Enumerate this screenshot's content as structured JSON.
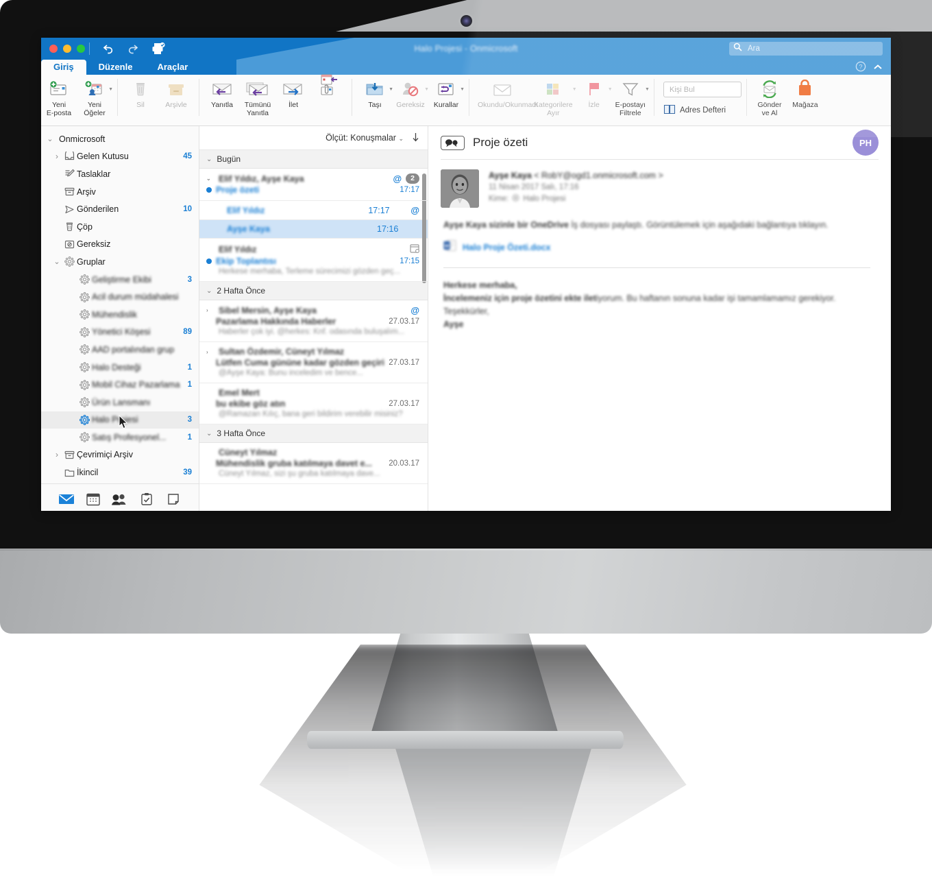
{
  "window": {
    "title": "Halo Projesi - Onmicrosoft",
    "search": {
      "placeholder": "Ara",
      "value": ""
    },
    "traffic_lights": [
      "close-red",
      "minimize-yellow",
      "zoom-green"
    ],
    "quick_access": [
      "undo-icon",
      "redo-icon",
      "print-icon"
    ],
    "help_icon": "help-circle-icon",
    "collapse_icon": "chevron-up-icon"
  },
  "ribbon": {
    "tabs": [
      {
        "label": "Giriş",
        "active": true
      },
      {
        "label": "Düzenle",
        "active": false
      },
      {
        "label": "Araçlar",
        "active": false
      }
    ],
    "groups": [
      {
        "items": [
          {
            "label": "Yeni\nE-posta",
            "icon": "new-email-icon",
            "dim": false,
            "caret": false
          },
          {
            "label": "Yeni\nÖğeler",
            "icon": "new-items-icon",
            "dim": false,
            "caret": true
          }
        ]
      },
      {
        "items": [
          {
            "label": "Sil",
            "icon": "trash-icon",
            "dim": true,
            "caret": false
          },
          {
            "label": "Arşivle",
            "icon": "archive-icon",
            "dim": true,
            "caret": false
          }
        ]
      },
      {
        "items": [
          {
            "label": "Yanıtla",
            "icon": "reply-icon",
            "dim": false,
            "caret": false
          },
          {
            "label": "Tümünü\nYanıtla",
            "icon": "reply-all-icon",
            "dim": false,
            "caret": false
          },
          {
            "label": "İlet",
            "icon": "forward-icon",
            "dim": false,
            "caret": false
          },
          {
            "label": "",
            "icon": "meeting-attachment-icon",
            "dim": false,
            "caret": false
          }
        ]
      },
      {
        "items": [
          {
            "label": "Taşı",
            "icon": "move-folder-icon",
            "dim": false,
            "caret": true
          },
          {
            "label": "Gereksiz",
            "icon": "junk-icon",
            "dim": true,
            "caret": true
          },
          {
            "label": "Kurallar",
            "icon": "rules-icon",
            "dim": false,
            "caret": true
          }
        ]
      },
      {
        "items": [
          {
            "label": "Okundu/Okunmadı",
            "icon": "envelope-icon",
            "dim": true,
            "caret": false
          },
          {
            "label": "Kategorilere\nAyır",
            "icon": "categorize-icon",
            "dim": true,
            "caret": true
          },
          {
            "label": "İzle",
            "icon": "flag-icon",
            "dim": true,
            "caret": true
          },
          {
            "label": "E-postayı\nFiltrele",
            "icon": "filter-funnel-icon",
            "dim": false,
            "caret": true
          }
        ]
      },
      {
        "items": [
          {
            "label": "Gönder\nve Al",
            "icon": "send-receive-icon",
            "dim": false,
            "caret": false
          },
          {
            "label": "Mağaza",
            "icon": "store-bag-icon",
            "dim": false,
            "caret": false
          }
        ]
      }
    ],
    "find_contact": {
      "placeholder": "Kişi Bul",
      "value": ""
    },
    "address_book_label": "Adres Defteri",
    "address_book_icon": "address-book-icon"
  },
  "sidebar": {
    "account": {
      "label": "Onmicrosoft",
      "icon": "chevron-down-icon",
      "indent": 0
    },
    "folders": [
      {
        "label": "Gelen Kutusu",
        "count": "45",
        "icon": "inbox-icon",
        "chevron": "chevron-right-icon",
        "indent": 1,
        "blurred": false
      },
      {
        "label": "Taslaklar",
        "count": "",
        "icon": "drafts-icon",
        "chevron": "",
        "indent": 1,
        "blurred": false
      },
      {
        "label": "Arşiv",
        "count": "",
        "icon": "archive-box-icon",
        "chevron": "",
        "indent": 1,
        "blurred": false
      },
      {
        "label": "Gönderilen",
        "count": "10",
        "icon": "sent-icon",
        "chevron": "",
        "indent": 1,
        "blurred": false
      },
      {
        "label": "Çöp",
        "count": "",
        "icon": "trash-icon",
        "chevron": "",
        "indent": 1,
        "blurred": false
      },
      {
        "label": "Gereksiz",
        "count": "",
        "icon": "junk-folder-icon",
        "chevron": "",
        "indent": 1,
        "blurred": false
      },
      {
        "label": "Gruplar",
        "count": "",
        "icon": "group-icon",
        "chevron": "chevron-down-icon",
        "indent": 1,
        "blurred": false
      },
      {
        "label": "Geliştirme Ekibi",
        "count": "3",
        "icon": "group-icon",
        "chevron": "",
        "indent": 2,
        "blurred": true
      },
      {
        "label": "Acil durum müdahalesi",
        "count": "",
        "icon": "group-icon",
        "chevron": "",
        "indent": 2,
        "blurred": true
      },
      {
        "label": "Mühendislik",
        "count": "",
        "icon": "group-icon",
        "chevron": "",
        "indent": 2,
        "blurred": true
      },
      {
        "label": "Yönetici Köşesi",
        "count": "89",
        "icon": "group-icon",
        "chevron": "",
        "indent": 2,
        "blurred": true
      },
      {
        "label": "AAD portalından grup",
        "count": "",
        "icon": "group-icon",
        "chevron": "",
        "indent": 2,
        "blurred": true
      },
      {
        "label": "Halo Desteği",
        "count": "1",
        "icon": "group-icon",
        "chevron": "",
        "indent": 2,
        "blurred": true
      },
      {
        "label": "Mobil Cihaz Pazarlama",
        "count": "1",
        "icon": "group-icon",
        "chevron": "",
        "indent": 2,
        "blurred": true
      },
      {
        "label": "Ürün Lansmanı",
        "count": "",
        "icon": "group-icon",
        "chevron": "",
        "indent": 2,
        "blurred": true
      },
      {
        "label": "Halo Projesi",
        "count": "3",
        "icon": "group-icon-selected",
        "chevron": "",
        "indent": 2,
        "blurred": true,
        "selected": true
      },
      {
        "label": "Satış Profesyonel...",
        "count": "1",
        "icon": "group-icon",
        "chevron": "",
        "indent": 2,
        "blurred": true
      },
      {
        "label": "Çevrimiçi Arşiv",
        "count": "",
        "icon": "archive-box-icon",
        "chevron": "chevron-right-icon",
        "indent": 1,
        "blurred": false
      },
      {
        "label": "İkincil",
        "count": "39",
        "icon": "folder-icon",
        "chevron": "",
        "indent": 1,
        "blurred": false
      }
    ],
    "nav_buttons": [
      {
        "icon": "mail-nav-icon",
        "active": true
      },
      {
        "icon": "calendar-nav-icon",
        "active": false
      },
      {
        "icon": "people-nav-icon",
        "active": false
      },
      {
        "icon": "tasks-nav-icon",
        "active": false
      },
      {
        "icon": "notes-nav-icon",
        "active": false
      }
    ]
  },
  "message_list": {
    "sort_label": "Ölçüt: Konuşmalar",
    "sort_caret_icon": "chevron-down-icon",
    "sort_direction_icon": "arrow-down-icon",
    "sections": [
      {
        "header": "Bugün",
        "conversations": [
          {
            "senders": "Elif Yıldız, Ayşe Kaya",
            "subject": "Proje özeti",
            "preview": "",
            "time": "17:17",
            "unread": true,
            "mention": true,
            "count_badge": "2",
            "expanded": true,
            "blurred": true,
            "children": [
              {
                "name": "Elif Yıldız",
                "time": "17:17",
                "mention": true,
                "selected": false
              },
              {
                "name": "Ayşe Kaya",
                "time": "17:16",
                "mention": false,
                "selected": true
              }
            ]
          },
          {
            "senders": "Elif Yıldız",
            "subject": "Ekip Toplantısı",
            "preview": "Herkese merhaba, Terleme sürecimizi gözden geç...",
            "time": "17:15",
            "unread": true,
            "mention": false,
            "count_badge": "",
            "calendar_icon": true,
            "expanded": false,
            "blurred": true,
            "children": []
          }
        ]
      },
      {
        "header": "2 Hafta Önce",
        "conversations": [
          {
            "senders": "Sibel Mersin, Ayşe Kaya",
            "subject": "Pazarlama Hakkında Haberler",
            "preview": "Haberler çok iyi. @herkes: Knf. odasında buluşalım...",
            "time": "27.03.17",
            "unread": false,
            "mention": true,
            "count_badge": "",
            "expanded": false,
            "collapsible": true,
            "blurred": true,
            "children": []
          },
          {
            "senders": "Sultan Özdemir, Cüneyt Yılmaz",
            "subject": "Lütfen Cuma gününe kadar gözden geçirin",
            "preview": "@Ayşe Kaya: Bunu inceledim ve bence...",
            "time": "27.03.17",
            "unread": false,
            "mention": false,
            "count_badge": "",
            "expanded": false,
            "collapsible": true,
            "blurred": true,
            "children": []
          },
          {
            "senders": "Emel Mert",
            "subject": "bu ekibe göz atın",
            "preview": "@Ramazan Kılıç, bana geri bildirim verebilir misiniz?",
            "time": "27.03.17",
            "unread": false,
            "mention": false,
            "count_badge": "",
            "expanded": false,
            "collapsible": false,
            "blurred": true,
            "children": []
          }
        ]
      },
      {
        "header": "3 Hafta Önce",
        "conversations": [
          {
            "senders": "Cüneyt Yılmaz",
            "subject": "Mühendislik gruba katılmaya davet e...",
            "preview": "Cüneyt Yılmaz, sizi şu gruba katılmaya dave...",
            "time": "20.03.17",
            "unread": false,
            "mention": false,
            "count_badge": "",
            "expanded": false,
            "collapsible": false,
            "blurred": true,
            "children": []
          }
        ]
      }
    ]
  },
  "reading_pane": {
    "conversation_icon": "conversation-bubbles-icon",
    "subject": "Proje özeti",
    "group_avatar_initials": "PH",
    "sender_name": "Ayşe Kaya",
    "sender_email": "< RobY@ogd1.onmicrosoft.com >",
    "date": "11 Nisan 2017 Salı, 17:16",
    "to_label": "Kime:",
    "to_value": "Halo Projesi",
    "to_icon": "group-small-icon",
    "onedrive_note_bold": "Ayşe Kaya sizinle bir OneDrive",
    "onedrive_note_rest": " İş dosyası paylaştı. Görüntülemek için aşağıdaki bağlantıya tıklayın.",
    "attachment": {
      "name": "Halo Proje Özeti.docx",
      "icon": "word-doc-icon"
    },
    "body_lines": [
      "Herkese merhaba,",
      "İncelemeniz için proje özetini ekte iletiyorum. Bu haftanın sonuna kadar işi tamamlamamız gerekiyor. Teşekkürler,",
      "Ayşe"
    ]
  },
  "colors": {
    "titlebar": "#1175c5",
    "titlebar_sheen": "#4b9bd8",
    "accent_blue": "#1a7fd4",
    "selected_row": "#cfe3f7",
    "group_avatar": "#9a8fd8",
    "store_orange": "#ef7032"
  }
}
